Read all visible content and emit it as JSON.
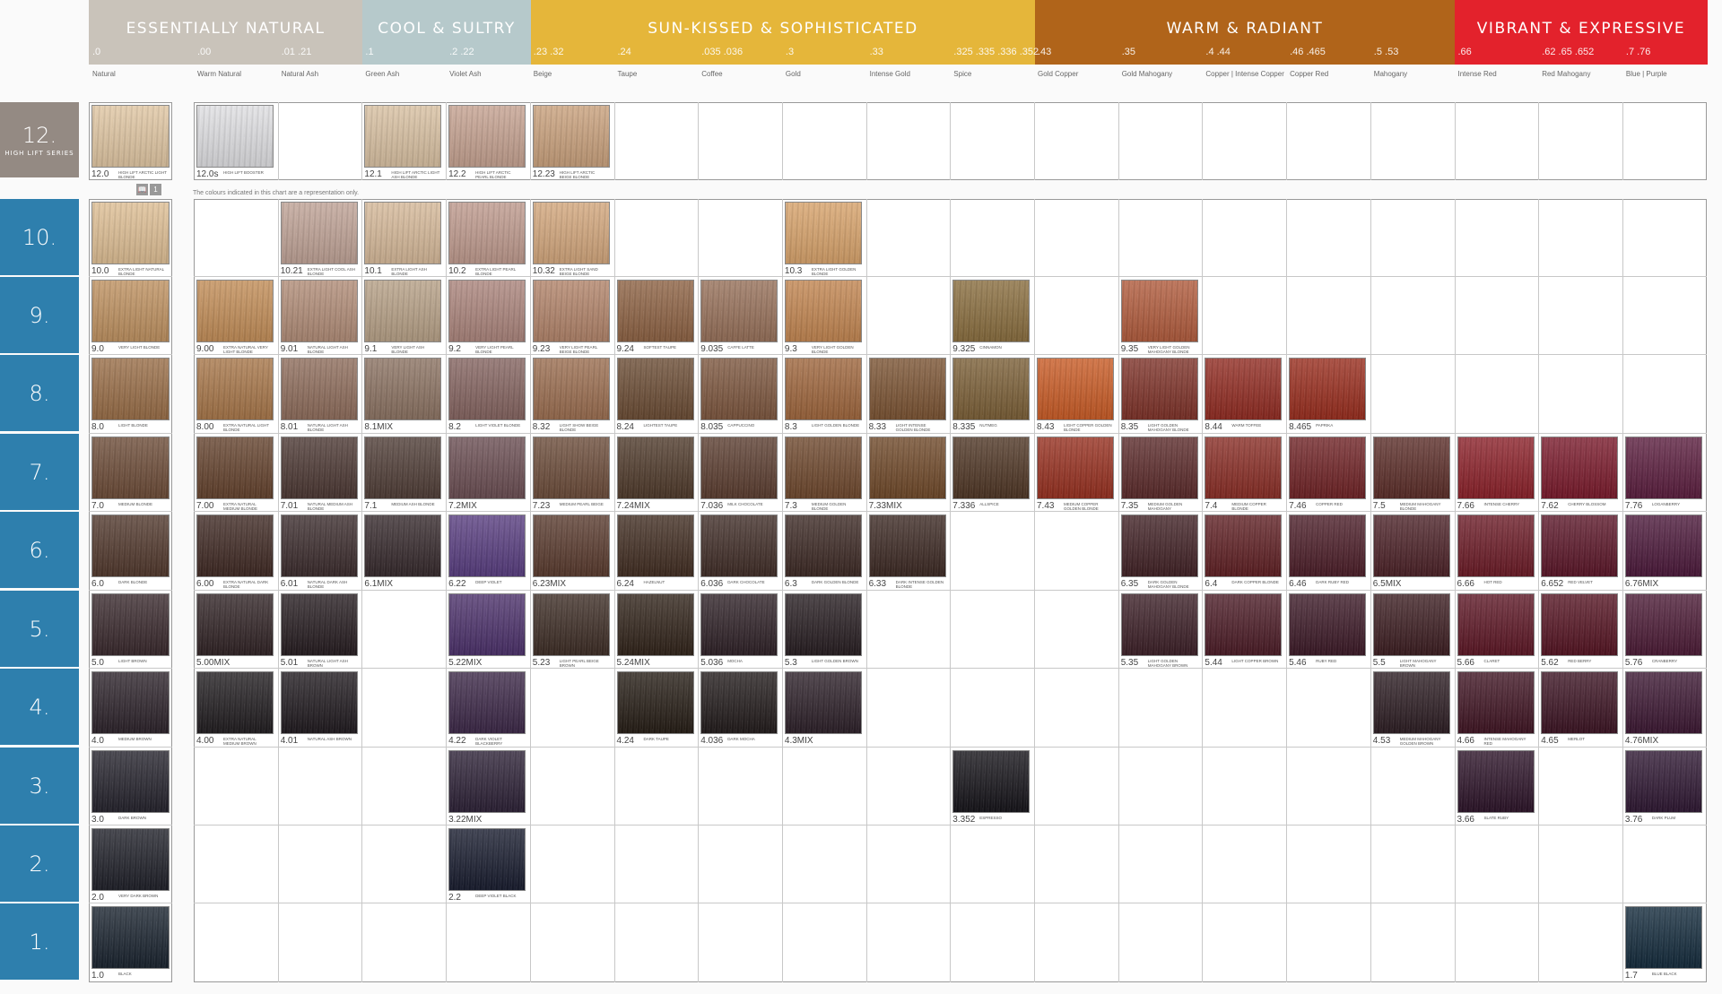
{
  "families": [
    {
      "name": "ESSENTIALLY NATURAL",
      "color": "#c9c3ba"
    },
    {
      "name": "COOL  &  SULTRY",
      "color": "#b6c9cb"
    },
    {
      "name": "SUN-KISSED    &  SOPHISTICATED",
      "color": "#e5b63a"
    },
    {
      "name": "WARM  &  RADIANT",
      "color": "#b0641a"
    },
    {
      "name": "VIBRANT  &  EXPRESSIVE",
      "color": "#e3222c"
    }
  ],
  "columns": [
    {
      "sub": ".0",
      "title": "Natural"
    },
    {
      "sub": ".00",
      "title": "Warm Natural"
    },
    {
      "sub": ".01 .21",
      "title": "Natural Ash"
    },
    {
      "sub": ".1",
      "title": "Green   Ash"
    },
    {
      "sub": ".2 .22",
      "title": "Violet  Ash"
    },
    {
      "sub": ".23 .32",
      "title": "Beige"
    },
    {
      "sub": ".24",
      "title": "Taupe"
    },
    {
      "sub": ".035 .036",
      "title": "Coffee"
    },
    {
      "sub": ".3",
      "title": "Gold"
    },
    {
      "sub": ".33",
      "title": "Intense Gold"
    },
    {
      "sub": ".325 .335 .336 .352",
      "title": "Spice"
    },
    {
      "sub": ".43",
      "title": "Gold Copper"
    },
    {
      "sub": ".35",
      "title": "Gold Mahogany"
    },
    {
      "sub": ".4 .44",
      "title": "Copper | Intense Copper"
    },
    {
      "sub": ".46 .465",
      "title": "Copper Red"
    },
    {
      "sub": ".5 .53",
      "title": "Mahogany"
    },
    {
      "sub": ".66",
      "title": "Intense Red"
    },
    {
      "sub": ".62 .65 .652",
      "title": "Red Mahogany"
    },
    {
      "sub": ".7 .76",
      "title": "Blue | Purple"
    }
  ],
  "levels": [
    {
      "num": "12.",
      "sub": "HIGH LIFT SERIES",
      "color": "#948a83"
    },
    {
      "num": "10.",
      "color": "#2e7fad"
    },
    {
      "num": "9.",
      "color": "#2e7fad"
    },
    {
      "num": "8.",
      "color": "#2e7fad"
    },
    {
      "num": "7.",
      "color": "#2e7fad"
    },
    {
      "num": "6.",
      "color": "#2e7fad"
    },
    {
      "num": "5.",
      "color": "#2e7fad"
    },
    {
      "num": "4.",
      "color": "#2e7fad"
    },
    {
      "num": "3.",
      "color": "#2e7fad"
    },
    {
      "num": "2.",
      "color": "#2e7fad"
    },
    {
      "num": "1.",
      "color": "#2e7fad"
    }
  ],
  "note": "The colours indicated in this chart are a representation only.",
  "book_icon": "open-book-icon",
  "book_num": "1",
  "swatches": [
    {
      "r": 0,
      "c": 0,
      "code": "12.0",
      "desc": "HIGH LIFT ARCTIC LIGHT BLONDE",
      "color": "#e4c9a4"
    },
    {
      "r": 0,
      "c": 1,
      "code": "12.0s",
      "desc": "HIGH LIFT BOOSTER",
      "color": "#e3e3e6"
    },
    {
      "r": 0,
      "c": 3,
      "code": "12.1",
      "desc": "HIGH LIFT ARCTIC LIGHT ASH BLONDE",
      "color": "#dcc3a3"
    },
    {
      "r": 0,
      "c": 4,
      "code": "12.2",
      "desc": "HIGH LIFT ARCTIC PEARL BLONDE",
      "color": "#c8a391"
    },
    {
      "r": 0,
      "c": 5,
      "code": "12.23",
      "desc": "HIGH LIFT ARCTIC BEIGE BLONDE",
      "color": "#cca27c"
    },
    {
      "r": 1,
      "c": 0,
      "code": "10.0",
      "desc": "EXTRA LIGHT NATURAL BLONDE",
      "color": "#e2c195"
    },
    {
      "r": 1,
      "c": 2,
      "code": "10.21",
      "desc": "EXTRA LIGHT COOL ASH BLONDE",
      "color": "#c2a497"
    },
    {
      "r": 1,
      "c": 3,
      "code": "10.1",
      "desc": "EXTRA LIGHT ASH BLONDE",
      "color": "#d9bb9a"
    },
    {
      "r": 1,
      "c": 4,
      "code": "10.2",
      "desc": "EXTRA LIGHT PEARL BLONDE",
      "color": "#c19b8e"
    },
    {
      "r": 1,
      "c": 5,
      "code": "10.32",
      "desc": "EXTRA LIGHT SAND BEIGE BLONDE",
      "color": "#d6a87c"
    },
    {
      "r": 1,
      "c": 8,
      "code": "10.3",
      "desc": "EXTRA LIGHT GOLDEN BLONDE",
      "color": "#dba46a"
    },
    {
      "r": 2,
      "c": 0,
      "code": "9.0",
      "desc": "VERY LIGHT BLONDE",
      "color": "#c1925f"
    },
    {
      "r": 2,
      "c": 1,
      "code": "9.00",
      "desc": "EXTRA NATURAL VERY LIGHT BLONDE",
      "color": "#c58e56"
    },
    {
      "r": 2,
      "c": 2,
      "code": "9.01",
      "desc": "NATURAL LIGHT ASH BLONDE",
      "color": "#b38d77"
    },
    {
      "r": 2,
      "c": 3,
      "code": "9.1",
      "desc": "VERY LIGHT ASH BLONDE",
      "color": "#b9a287"
    },
    {
      "r": 2,
      "c": 4,
      "code": "9.2",
      "desc": "VERY LIGHT PEARL BLONDE",
      "color": "#ad857c"
    },
    {
      "r": 2,
      "c": 5,
      "code": "9.23",
      "desc": "VERY LIGHT PEARL BEIGE BLONDE",
      "color": "#b48469"
    },
    {
      "r": 2,
      "c": 6,
      "code": "9.24",
      "desc": "SOFTEST TAUPE",
      "color": "#8e6141"
    },
    {
      "r": 2,
      "c": 7,
      "code": "9.035",
      "desc": "CAFFE LATTE",
      "color": "#987058"
    },
    {
      "r": 2,
      "c": 8,
      "code": "9.3",
      "desc": "VERY LIGHT GOLDEN BLONDE",
      "color": "#c5864f"
    },
    {
      "r": 2,
      "c": 10,
      "code": "9.325",
      "desc": "CINNAMON",
      "color": "#8a6d3c"
    },
    {
      "r": 2,
      "c": 12,
      "code": "9.35",
      "desc": "VERY LIGHT GOLDEN MAHOGANY BLONDE",
      "color": "#b35a3a"
    },
    {
      "r": 3,
      "c": 0,
      "code": "8.0",
      "desc": "LIGHT BLONDE",
      "color": "#9a6d45"
    },
    {
      "r": 3,
      "c": 1,
      "code": "8.00",
      "desc": "EXTRA NATURAL LIGHT BLONDE",
      "color": "#a97647"
    },
    {
      "r": 3,
      "c": 2,
      "code": "8.01",
      "desc": "NATURAL LIGHT ASH BLONDE",
      "color": "#8f6c5a"
    },
    {
      "r": 3,
      "c": 3,
      "code": "8.1MIX",
      "desc": "",
      "color": "#8c7261"
    },
    {
      "r": 3,
      "c": 4,
      "code": "8.2",
      "desc": "LIGHT VIOLET BLONDE",
      "color": "#85635f"
    },
    {
      "r": 3,
      "c": 5,
      "code": "8.32",
      "desc": "LIGHT SHOW BEIGE BLONDE",
      "color": "#9c6d4e"
    },
    {
      "r": 3,
      "c": 6,
      "code": "8.24",
      "desc": "LIGHTEST TAUPE",
      "color": "#6a4a31"
    },
    {
      "r": 3,
      "c": 7,
      "code": "8.035",
      "desc": "CAPPUCCINO",
      "color": "#7d553c"
    },
    {
      "r": 3,
      "c": 8,
      "code": "8.3",
      "desc": "LIGHT GOLDEN BLONDE",
      "color": "#a0653a"
    },
    {
      "r": 3,
      "c": 9,
      "code": "8.33",
      "desc": "LIGHT INTENSE GOLDEN BLONDE",
      "color": "#7b5230"
    },
    {
      "r": 3,
      "c": 10,
      "code": "8.335",
      "desc": "NUTMEG",
      "color": "#7b5e34"
    },
    {
      "r": 3,
      "c": 11,
      "code": "8.43",
      "desc": "LIGHT COPPER GOLDEN BLONDE",
      "color": "#cc5a22"
    },
    {
      "r": 3,
      "c": 12,
      "code": "8.35",
      "desc": "LIGHT GOLDEN MAHOGANY BLONDE",
      "color": "#7e2f25"
    },
    {
      "r": 3,
      "c": 13,
      "code": "8.44",
      "desc": "WARM TOFFEE",
      "color": "#92281e"
    },
    {
      "r": 3,
      "c": 14,
      "code": "8.465",
      "desc": "PAPRIKA",
      "color": "#9a2a1a"
    },
    {
      "r": 4,
      "c": 0,
      "code": "7.0",
      "desc": "MEDIUM BLONDE",
      "color": "#6c4a35"
    },
    {
      "r": 4,
      "c": 1,
      "code": "7.00",
      "desc": "EXTRA NATURAL MEDIUM BLONDE",
      "color": "#63402a"
    },
    {
      "r": 4,
      "c": 2,
      "code": "7.01",
      "desc": "NATURAL MEDIUM ASH BLONDE",
      "color": "#4a3530"
    },
    {
      "r": 4,
      "c": 3,
      "code": "7.1",
      "desc": "MEDIUM ASH BLONDE",
      "color": "#4e3b34"
    },
    {
      "r": 4,
      "c": 4,
      "code": "7.2MIX",
      "desc": "",
      "color": "#6a4c51"
    },
    {
      "r": 4,
      "c": 5,
      "code": "7.23",
      "desc": "MEDIUM PEARL BEIGE",
      "color": "#6b4a37"
    },
    {
      "r": 4,
      "c": 6,
      "code": "7.24MIX",
      "desc": "",
      "color": "#4d3727"
    },
    {
      "r": 4,
      "c": 7,
      "code": "7.036",
      "desc": "MILK CHOCOLATE",
      "color": "#5a3b2d"
    },
    {
      "r": 4,
      "c": 8,
      "code": "7.3",
      "desc": "MEDIUM GOLDEN BLONDE",
      "color": "#6e462a"
    },
    {
      "r": 4,
      "c": 9,
      "code": "7.33MIX",
      "desc": "",
      "color": "#6f4726"
    },
    {
      "r": 4,
      "c": 10,
      "code": "7.336",
      "desc": "ALLSPICE",
      "color": "#4d3321"
    },
    {
      "r": 4,
      "c": 11,
      "code": "7.43",
      "desc": "MEDIUM COPPER GOLDEN BLONDE",
      "color": "#982d1c"
    },
    {
      "r": 4,
      "c": 12,
      "code": "7.35",
      "desc": "MEDIUM GOLDEN MAHOGANY",
      "color": "#5a2727"
    },
    {
      "r": 4,
      "c": 13,
      "code": "7.4",
      "desc": "MEDIUM COPPER BLONDE",
      "color": "#8a2a22"
    },
    {
      "r": 4,
      "c": 14,
      "code": "7.46",
      "desc": "COPPER RED",
      "color": "#6f1f22"
    },
    {
      "r": 4,
      "c": 15,
      "code": "7.5",
      "desc": "MEDIUM MAHOGANY BLONDE",
      "color": "#5a2a25"
    },
    {
      "r": 4,
      "c": 16,
      "code": "7.66",
      "desc": "INTENSE CHERRY",
      "color": "#8c1d26"
    },
    {
      "r": 4,
      "c": 17,
      "code": "7.62",
      "desc": "CHERRY BLOSSOM",
      "color": "#7a1628"
    },
    {
      "r": 4,
      "c": 18,
      "code": "7.76",
      "desc": "LOGANBERRY",
      "color": "#5a1a3c"
    },
    {
      "r": 5,
      "c": 0,
      "code": "6.0",
      "desc": "DARK BLONDE",
      "color": "#50362a"
    },
    {
      "r": 5,
      "c": 1,
      "code": "6.00",
      "desc": "EXTRA NATURAL DARK BLONDE",
      "color": "#3d2620"
    },
    {
      "r": 5,
      "c": 2,
      "code": "6.01",
      "desc": "NATURAL DARK ASH BLONDE",
      "color": "#39292a"
    },
    {
      "r": 5,
      "c": 3,
      "code": "6.1MIX",
      "desc": "",
      "color": "#332629"
    },
    {
      "r": 5,
      "c": 4,
      "code": "6.22",
      "desc": "DEEP VIOLET",
      "color": "#573b80"
    },
    {
      "r": 5,
      "c": 5,
      "code": "6.23MIX",
      "desc": "",
      "color": "#58382b"
    },
    {
      "r": 5,
      "c": 6,
      "code": "6.24",
      "desc": "HAZELNUT",
      "color": "#3f2a1e"
    },
    {
      "r": 5,
      "c": 7,
      "code": "6.036",
      "desc": "DARK CHOCOLATE",
      "color": "#3e2a24"
    },
    {
      "r": 5,
      "c": 8,
      "code": "6.3",
      "desc": "DARK GOLDEN BLONDE",
      "color": "#3a2621"
    },
    {
      "r": 5,
      "c": 9,
      "code": "6.33",
      "desc": "DARK INTENSE GOLDEN BLONDE",
      "color": "#3a2620"
    },
    {
      "r": 5,
      "c": 12,
      "code": "6.35",
      "desc": "DARK GOLDEN MAHOGANY BLONDE",
      "color": "#3f1e22"
    },
    {
      "r": 5,
      "c": 13,
      "code": "6.4",
      "desc": "DARK COPPER BLONDE",
      "color": "#5e1c20"
    },
    {
      "r": 5,
      "c": 14,
      "code": "6.46",
      "desc": "DARK RUBY RED",
      "color": "#4a1a25"
    },
    {
      "r": 5,
      "c": 15,
      "code": "6.5MIX",
      "desc": "",
      "color": "#4a1e24"
    },
    {
      "r": 5,
      "c": 16,
      "code": "6.66",
      "desc": "HOT RED",
      "color": "#6b1723"
    },
    {
      "r": 5,
      "c": 17,
      "code": "6.652",
      "desc": "RED VELVET",
      "color": "#5a1225"
    },
    {
      "r": 5,
      "c": 18,
      "code": "6.76MIX",
      "desc": "",
      "color": "#4a1538"
    },
    {
      "r": 6,
      "c": 0,
      "code": "5.0",
      "desc": "LIGHT BROWN",
      "color": "#37262a"
    },
    {
      "r": 6,
      "c": 1,
      "code": "5.00MIX",
      "desc": "",
      "color": "#2e2022"
    },
    {
      "r": 6,
      "c": 2,
      "code": "5.01",
      "desc": "NATURAL LIGHT ASH BROWN",
      "color": "#23191d"
    },
    {
      "r": 6,
      "c": 4,
      "code": "5.22MIX",
      "desc": "",
      "color": "#4a2e6a"
    },
    {
      "r": 6,
      "c": 5,
      "code": "5.23",
      "desc": "LIGHT PEARL BEIGE BROWN",
      "color": "#3b2a22"
    },
    {
      "r": 6,
      "c": 6,
      "code": "5.24MIX",
      "desc": "",
      "color": "#2e2016"
    },
    {
      "r": 6,
      "c": 7,
      "code": "5.036",
      "desc": "MOCHA",
      "color": "#2c1e24"
    },
    {
      "r": 6,
      "c": 8,
      "code": "5.3",
      "desc": "LIGHT GOLDEN BROWN",
      "color": "#241a1e"
    },
    {
      "r": 6,
      "c": 12,
      "code": "5.35",
      "desc": "LIGHT GOLDEN MAHOGANY BROWN",
      "color": "#3a1c24"
    },
    {
      "r": 6,
      "c": 13,
      "code": "5.44",
      "desc": "LIGHT COPPER BROWN",
      "color": "#4a1823"
    },
    {
      "r": 6,
      "c": 14,
      "code": "5.46",
      "desc": "RUBY RED",
      "color": "#3a1624"
    },
    {
      "r": 6,
      "c": 15,
      "code": "5.5",
      "desc": "LIGHT MAHOGANY BROWN",
      "color": "#3a1a1e"
    },
    {
      "r": 6,
      "c": 16,
      "code": "5.66",
      "desc": "CLARET",
      "color": "#5c1322"
    },
    {
      "r": 6,
      "c": 17,
      "code": "5.62",
      "desc": "RED BERRY",
      "color": "#54101f"
    },
    {
      "r": 6,
      "c": 18,
      "code": "5.76",
      "desc": "CRANBERRY",
      "color": "#4a1733"
    },
    {
      "r": 7,
      "c": 0,
      "code": "4.0",
      "desc": "MEDIUM BROWN",
      "color": "#2a2028"
    },
    {
      "r": 7,
      "c": 1,
      "code": "4.00",
      "desc": "EXTRA NATURAL MEDIUM BROWN",
      "color": "#1e1a1d"
    },
    {
      "r": 7,
      "c": 2,
      "code": "4.01",
      "desc": "NATURAL ASH BROWN",
      "color": "#1d171c"
    },
    {
      "r": 7,
      "c": 4,
      "code": "4.22",
      "desc": "DARK VIOLET BLACKBERRY",
      "color": "#3a2546"
    },
    {
      "r": 7,
      "c": 6,
      "code": "4.24",
      "desc": "DARK TAUPE",
      "color": "#231a12"
    },
    {
      "r": 7,
      "c": 7,
      "code": "4.036",
      "desc": "DARK MOCHA",
      "color": "#1f1818"
    },
    {
      "r": 7,
      "c": 8,
      "code": "4.3MIX",
      "desc": "",
      "color": "#2a1d26"
    },
    {
      "r": 7,
      "c": 15,
      "code": "4.53",
      "desc": "MEDIUM MAHOGANY GOLDEN BROWN",
      "color": "#2a1a20"
    },
    {
      "r": 7,
      "c": 16,
      "code": "4.66",
      "desc": "INTENSE MAHOGANY RED",
      "color": "#3e1120"
    },
    {
      "r": 7,
      "c": 17,
      "code": "4.65",
      "desc": "MERLOT",
      "color": "#3a1020"
    },
    {
      "r": 7,
      "c": 18,
      "code": "4.76MIX",
      "desc": "",
      "color": "#3a1430"
    },
    {
      "r": 8,
      "c": 0,
      "code": "3.0",
      "desc": "DARK BROWN",
      "color": "#22202a"
    },
    {
      "r": 8,
      "c": 4,
      "code": "3.22MIX",
      "desc": "",
      "color": "#2a1e34"
    },
    {
      "r": 8,
      "c": 10,
      "code": "3.352",
      "desc": "ESPRESSO",
      "color": "#121016"
    },
    {
      "r": 8,
      "c": 16,
      "code": "3.66",
      "desc": "SLATE RUBY",
      "color": "#2a1026"
    },
    {
      "r": 8,
      "c": 18,
      "code": "3.76",
      "desc": "DARK PLUM",
      "color": "#2c1430"
    },
    {
      "r": 9,
      "c": 0,
      "code": "2.0",
      "desc": "VERY DARK BROWN",
      "color": "#1c1d26"
    },
    {
      "r": 9,
      "c": 4,
      "code": "2.2",
      "desc": "DEEP VIOLET BLACK",
      "color": "#15192c"
    },
    {
      "r": 10,
      "c": 0,
      "code": "1.0",
      "desc": "BLACK",
      "color": "#16202c"
    },
    {
      "r": 10,
      "c": 18,
      "code": "1.7",
      "desc": "BLUE BLACK",
      "color": "#10283a"
    }
  ]
}
